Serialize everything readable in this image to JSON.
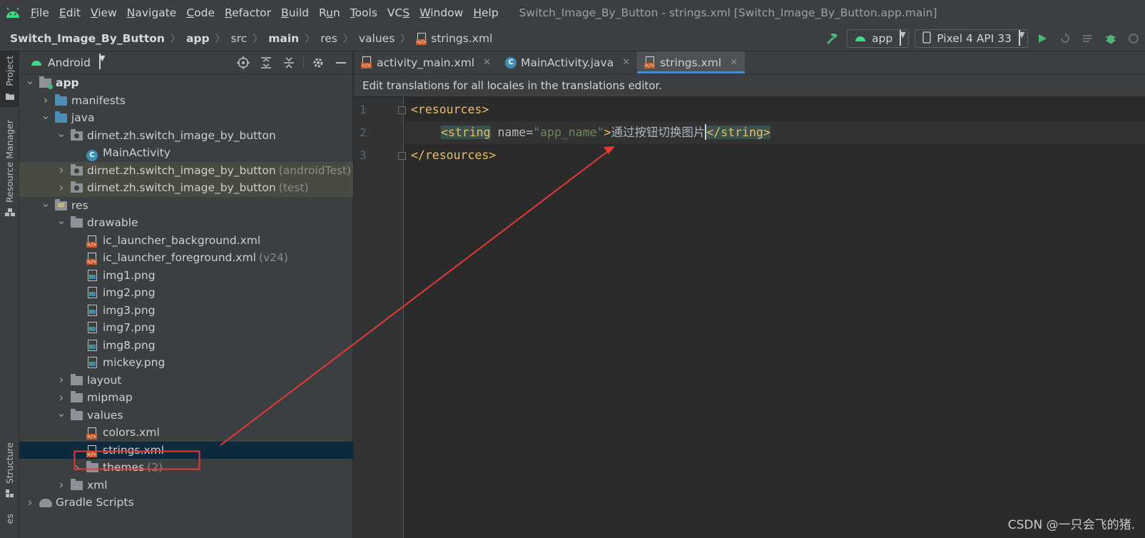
{
  "menu": {
    "items": [
      {
        "label": "File",
        "mnemonic": "F"
      },
      {
        "label": "Edit",
        "mnemonic": "E"
      },
      {
        "label": "View",
        "mnemonic": "V"
      },
      {
        "label": "Navigate",
        "mnemonic": "N"
      },
      {
        "label": "Code",
        "mnemonic": "C"
      },
      {
        "label": "Refactor",
        "mnemonic": "R"
      },
      {
        "label": "Build",
        "mnemonic": "B"
      },
      {
        "label": "Run",
        "mnemonic": "u"
      },
      {
        "label": "Tools",
        "mnemonic": "T"
      },
      {
        "label": "VCS",
        "mnemonic": "S"
      },
      {
        "label": "Window",
        "mnemonic": "W"
      },
      {
        "label": "Help",
        "mnemonic": "H"
      }
    ],
    "window_title": "Switch_Image_By_Button - strings.xml [Switch_Image_By_Button.app.main]"
  },
  "breadcrumb": {
    "items": [
      {
        "label": "Switch_Image_By_Button",
        "bold": true
      },
      {
        "label": "app",
        "bold": true
      },
      {
        "label": "src",
        "bold": false
      },
      {
        "label": "main",
        "bold": true
      },
      {
        "label": "res",
        "bold": false
      },
      {
        "label": "values",
        "bold": false
      },
      {
        "label": "strings.xml",
        "bold": false,
        "icon": "xml-file-icon"
      }
    ]
  },
  "run_toolbar": {
    "config": "app",
    "device": "Pixel 4 API 33"
  },
  "left_strip": {
    "project_label": "Project",
    "resource_manager_label": "Resource Manager",
    "structure_label": "Structure",
    "bottom_label": "es"
  },
  "project_panel": {
    "view_mode": "Android"
  },
  "tree": [
    {
      "label": "app",
      "depth": 0,
      "arrow": "open",
      "icon": "module",
      "bold": true
    },
    {
      "label": "manifests",
      "depth": 1,
      "arrow": "closed",
      "icon": "folder-blue"
    },
    {
      "label": "java",
      "depth": 1,
      "arrow": "open",
      "icon": "folder-blue"
    },
    {
      "label": "dirnet.zh.switch_image_by_button",
      "depth": 2,
      "arrow": "open",
      "icon": "package"
    },
    {
      "label": "MainActivity",
      "depth": 3,
      "arrow": "none",
      "icon": "class"
    },
    {
      "label": "dirnet.zh.switch_image_by_button",
      "suffix": "(androidTest)",
      "depth": 2,
      "arrow": "closed",
      "icon": "package",
      "highlight": "green"
    },
    {
      "label": "dirnet.zh.switch_image_by_button",
      "suffix": "(test)",
      "depth": 2,
      "arrow": "closed",
      "icon": "package",
      "highlight": "green"
    },
    {
      "label": "res",
      "depth": 1,
      "arrow": "open",
      "icon": "folder-res"
    },
    {
      "label": "drawable",
      "depth": 2,
      "arrow": "open",
      "icon": "folder"
    },
    {
      "label": "ic_launcher_background.xml",
      "depth": 3,
      "arrow": "none",
      "icon": "xml"
    },
    {
      "label": "ic_launcher_foreground.xml",
      "suffix": "(v24)",
      "depth": 3,
      "arrow": "none",
      "icon": "xml"
    },
    {
      "label": "img1.png",
      "depth": 3,
      "arrow": "none",
      "icon": "png"
    },
    {
      "label": "img2.png",
      "depth": 3,
      "arrow": "none",
      "icon": "png"
    },
    {
      "label": "img3.png",
      "depth": 3,
      "arrow": "none",
      "icon": "png"
    },
    {
      "label": "img7.png",
      "depth": 3,
      "arrow": "none",
      "icon": "png"
    },
    {
      "label": "img8.png",
      "depth": 3,
      "arrow": "none",
      "icon": "png"
    },
    {
      "label": "mickey.png",
      "depth": 3,
      "arrow": "none",
      "icon": "png"
    },
    {
      "label": "layout",
      "depth": 2,
      "arrow": "closed",
      "icon": "folder"
    },
    {
      "label": "mipmap",
      "depth": 2,
      "arrow": "closed",
      "icon": "folder"
    },
    {
      "label": "values",
      "depth": 2,
      "arrow": "open",
      "icon": "folder"
    },
    {
      "label": "colors.xml",
      "depth": 3,
      "arrow": "none",
      "icon": "xml"
    },
    {
      "label": "strings.xml",
      "depth": 3,
      "arrow": "none",
      "icon": "xml",
      "selected": true
    },
    {
      "label": "themes",
      "suffix": "(2)",
      "depth": 3,
      "arrow": "closed",
      "icon": "folder"
    },
    {
      "label": "xml",
      "depth": 2,
      "arrow": "closed",
      "icon": "folder"
    },
    {
      "label": "Gradle Scripts",
      "depth": 0,
      "arrow": "closed",
      "icon": "gradle"
    }
  ],
  "editor": {
    "tabs": [
      {
        "label": "activity_main.xml",
        "icon": "xml",
        "active": false
      },
      {
        "label": "MainActivity.java",
        "icon": "class",
        "active": false
      },
      {
        "label": "strings.xml",
        "icon": "xml",
        "active": true
      }
    ],
    "notice": "Edit translations for all locales in the translations editor.",
    "line_numbers": [
      "1",
      "2",
      "3"
    ],
    "code": {
      "l1_open": "<resources>",
      "l2_open": "<string",
      "l2_attr": "name",
      "l2_eq": "=",
      "l2_val": "\"app_name\"",
      "l2_gt": ">",
      "l2_text": "通过按钮切换图片",
      "l2_close": "</string>",
      "l3_close": "</resources>"
    }
  },
  "watermark": "CSDN @一只会飞的猪.",
  "annotation": {
    "color": "#e53935"
  }
}
